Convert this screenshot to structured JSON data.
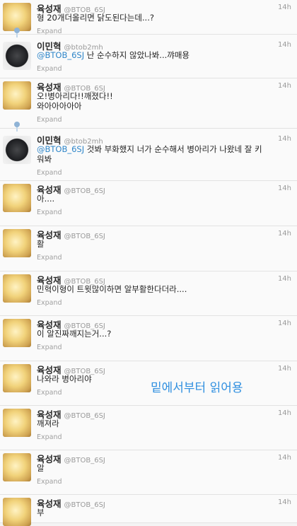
{
  "tweets": [
    {
      "avatar": "chick",
      "name": "육성재",
      "handle": "@BTOB_6SJ",
      "time": "14h",
      "text": "형 20개더올리면 닭도된다는데...?",
      "expand": "Expand"
    },
    {
      "avatar": "crow",
      "name": "이민혁",
      "handle": "@btob2mh",
      "time": "14h",
      "mention": "@BTOB_6SJ",
      "text": " 난 순수하지 않았나봐...꺄매용",
      "expand": "Expand"
    },
    {
      "avatar": "chick",
      "name": "육성재",
      "handle": "@BTOB_6SJ",
      "time": "14h",
      "text": "오!병아리다!!깨졌다!!",
      "text2": "와아아아아아",
      "expand": "Expand"
    },
    {
      "avatar": "crow",
      "name": "이민혁",
      "handle": "@btob2mh",
      "time": "14h",
      "mention": "@BTOB_6SJ",
      "text": " 것봐 부화했지 너가 순수해서 병아리가 나왔네 잘 키",
      "text2": "워봐",
      "expand": "Expand"
    },
    {
      "avatar": "chick",
      "name": "육성재",
      "handle": "@BTOB_6SJ",
      "time": "14h",
      "text": "아....",
      "expand": "Expand"
    },
    {
      "avatar": "chick",
      "name": "육성재",
      "handle": "@BTOB_6SJ",
      "time": "14h",
      "text": "활",
      "expand": "Expand"
    },
    {
      "avatar": "chick",
      "name": "육성재",
      "handle": "@BTOB_6SJ",
      "time": "14h",
      "text": "민혁이형이 트윗많이하면 알부활한다더라....",
      "expand": "Expand"
    },
    {
      "avatar": "chick",
      "name": "육성재",
      "handle": "@BTOB_6SJ",
      "time": "14h",
      "text": "이 알진짜깨지는거...?",
      "expand": "Expand"
    },
    {
      "avatar": "chick",
      "name": "육성재",
      "handle": "@BTOB_6SJ",
      "time": "14h",
      "text": "나와라 병아리야",
      "expand": "Expand"
    },
    {
      "avatar": "chick",
      "name": "육성재",
      "handle": "@BTOB_6SJ",
      "time": "14h",
      "text": "깨져라",
      "expand": "Expand"
    },
    {
      "avatar": "chick",
      "name": "육성재",
      "handle": "@BTOB_6SJ",
      "time": "14h",
      "text": "알",
      "expand": "Expand"
    },
    {
      "avatar": "chick",
      "name": "육성재",
      "handle": "@BTOB_6SJ",
      "time": "14h",
      "text": "부",
      "expand": ""
    }
  ],
  "overlay_note": "밑에서부터 읽어용",
  "colors": {
    "mention": "#2f86c9",
    "overlay": "#2f8fe0",
    "thread": "#8fb3d6"
  }
}
